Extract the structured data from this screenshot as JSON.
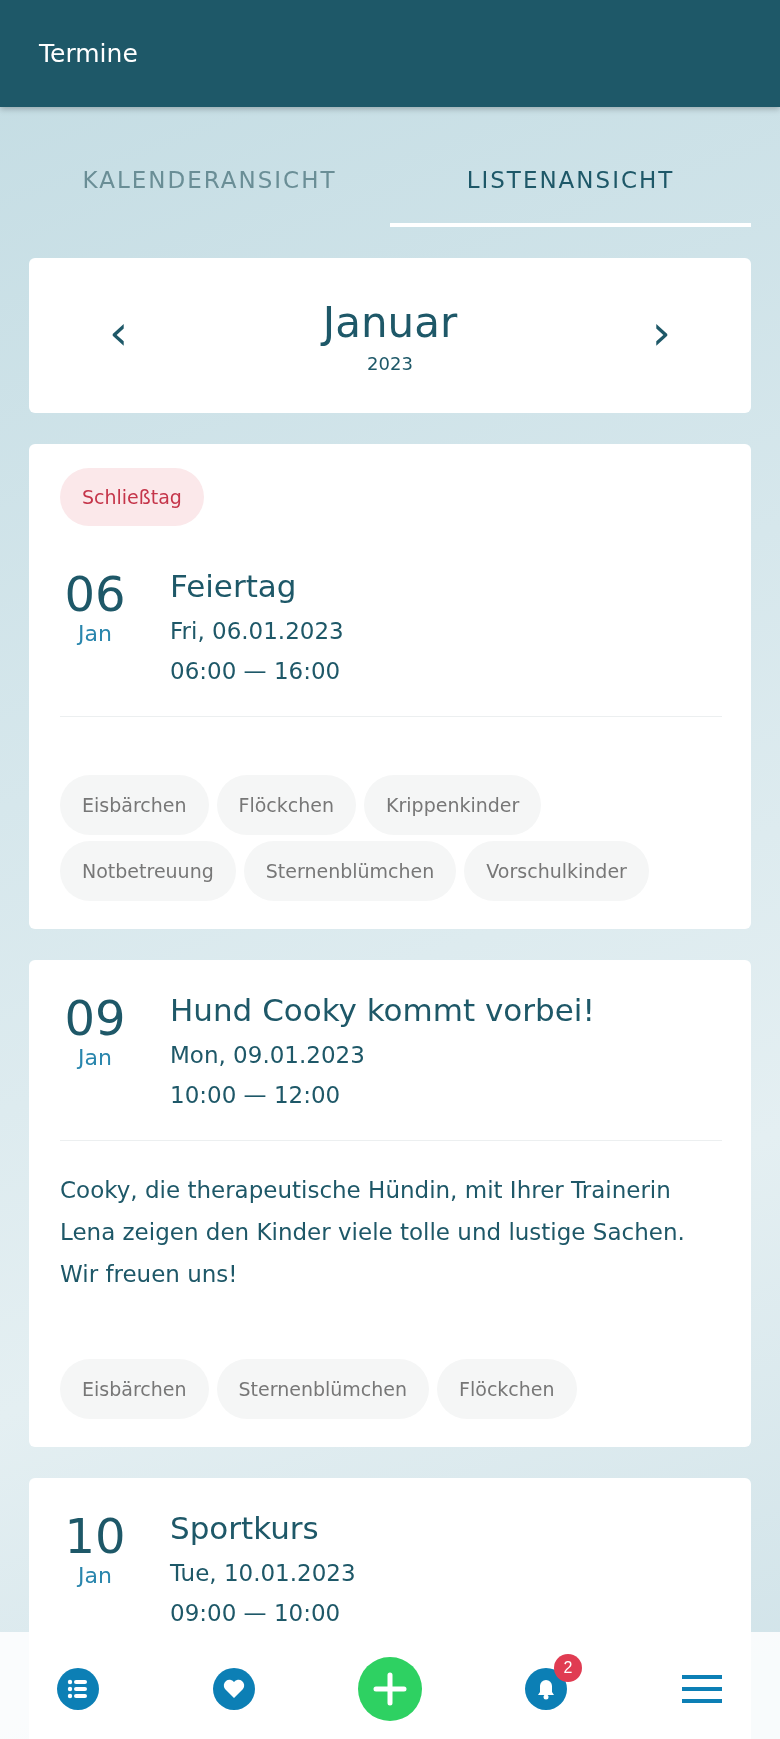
{
  "app_bar": {
    "title": "Termine"
  },
  "tabs": [
    {
      "label": "KALENDERANSICHT",
      "selected": false
    },
    {
      "label": "LISTENANSICHT",
      "selected": true
    }
  ],
  "month_nav": {
    "prev": "‹",
    "month": "Januar",
    "year": "2023",
    "next": "›"
  },
  "events": [
    {
      "badge": "Schließtag",
      "day": "06",
      "month": "Jan",
      "title": "Feiertag",
      "date": "Fri, 06.01.2023",
      "time": "06:00 — 16:00",
      "tags": [
        "Eisbärchen",
        "Flöckchen",
        "Krippenkinder",
        "Notbetreuung",
        "Sternenblümchen",
        "Vorschulkinder"
      ]
    },
    {
      "day": "09",
      "month": "Jan",
      "title": "Hund Cooky kommt vorbei!",
      "date": "Mon, 09.01.2023",
      "time": "10:00 — 12:00",
      "description": "Cooky, die therapeutische Hündin, mit Ihrer Trainerin Lena zeigen den Kinder viele tolle und lustige Sachen. Wir freuen uns!",
      "tags": [
        "Eisbärchen",
        "Sternenblümchen",
        "Flöckchen"
      ]
    },
    {
      "day": "10",
      "month": "Jan",
      "title": "Sportkurs",
      "date": "Tue, 10.01.2023",
      "time": "09:00 — 10:00"
    }
  ],
  "bottom_nav": [
    {
      "kind": "list"
    },
    {
      "kind": "heart"
    },
    {
      "kind": "add"
    },
    {
      "kind": "bell",
      "badge": "2"
    },
    {
      "kind": "menu"
    }
  ]
}
